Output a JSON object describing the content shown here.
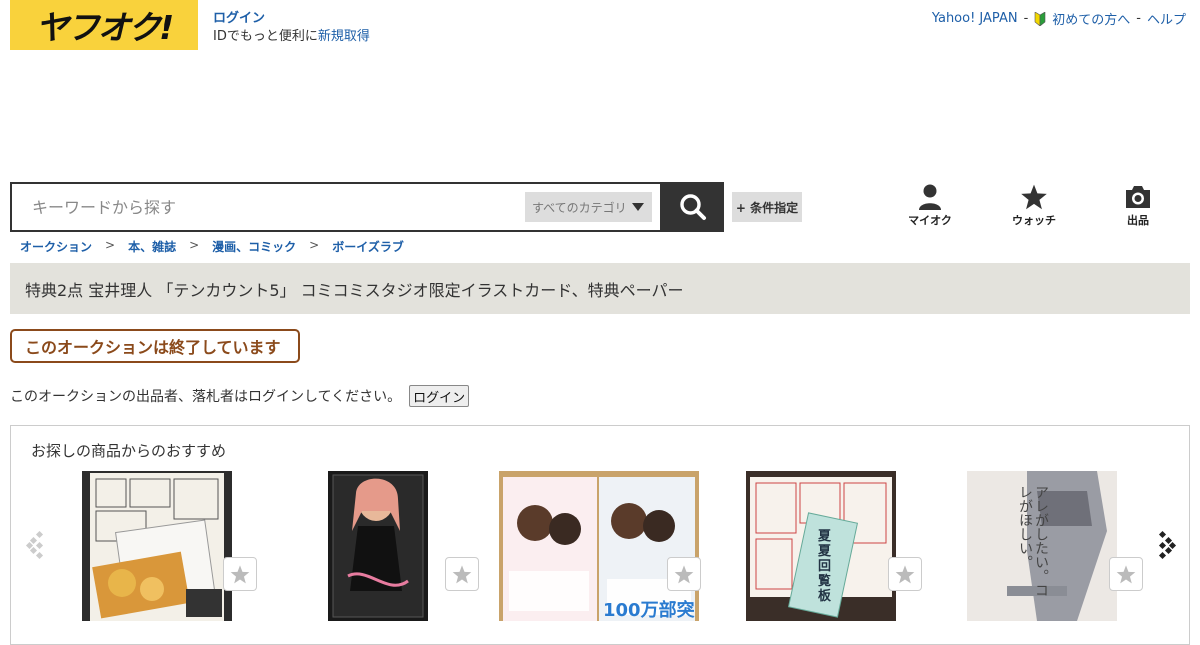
{
  "header": {
    "logo": "ヤフオク!",
    "login_link": "ログイン",
    "login_sub_prefix": "IDでもっと便利に",
    "register_link": "新規取得",
    "top_links": [
      "Yahoo! JAPAN",
      "初めての方へ",
      "ヘルプ"
    ],
    "separator": "-"
  },
  "search": {
    "placeholder": "キーワードから探す",
    "category": "すべてのカテゴリ",
    "condition_button": "+ 条件指定"
  },
  "nav_icons": [
    {
      "label": "マイオク",
      "icon": "person-icon"
    },
    {
      "label": "ウォッチ",
      "icon": "star-icon"
    },
    {
      "label": "出品",
      "icon": "camera-icon"
    }
  ],
  "breadcrumb": [
    "オークション",
    "本、雑誌",
    "漫画、コミック",
    "ボーイズラブ"
  ],
  "breadcrumb_sep": ">",
  "item_title": "特典2点 宝井理人 「テンカウント5」 コミコミスタジオ限定イラストカード、特典ペーパー",
  "ended_badge": "このオークションは終了しています",
  "login_prompt": {
    "text": "このオークションの出品者、落札者はログインしてください。",
    "button": "ログイン"
  },
  "recommend": {
    "title": "お探しの商品からのおすすめ",
    "items": [
      {
        "name": "manga-cards-photo"
      },
      {
        "name": "black-dress-photo"
      },
      {
        "name": "two-manga-volumes-photo",
        "visible_text": "100万部突破"
      },
      {
        "name": "manga-paper-photo",
        "visible_text": "夏夏回覧板"
      },
      {
        "name": "bl-cover-photo",
        "visible_text": "アレがしたい。コレがほしい。"
      }
    ]
  },
  "colors": {
    "logo_bg": "#f9d23c",
    "link": "#1e5fa8",
    "ended_border": "#8b4a1b",
    "title_bar_bg": "#e3e2dc"
  }
}
